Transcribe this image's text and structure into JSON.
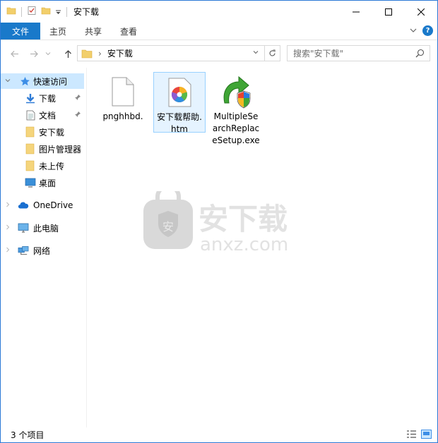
{
  "window": {
    "title": "安下载",
    "accent": "#1979ca"
  },
  "ribbon": {
    "tabs": [
      "文件",
      "主页",
      "共享",
      "查看"
    ],
    "help_label": "?"
  },
  "address": {
    "crumb": "安下载",
    "separator": "›"
  },
  "search": {
    "placeholder": "搜索\"安下载\""
  },
  "navpane": {
    "quick_access": "快速访问",
    "items": [
      {
        "label": "下载",
        "icon": "download-icon",
        "pinned": true
      },
      {
        "label": "文档",
        "icon": "document-icon",
        "pinned": true
      },
      {
        "label": "安下载",
        "icon": "folder-icon",
        "pinned": false
      },
      {
        "label": "图片管理器",
        "icon": "folder-icon",
        "pinned": false
      },
      {
        "label": "未上传",
        "icon": "folder-icon",
        "pinned": false
      },
      {
        "label": "桌面",
        "icon": "desktop-icon",
        "pinned": false
      }
    ],
    "onedrive": "OneDrive",
    "this_pc": "此电脑",
    "network": "网络"
  },
  "files": [
    {
      "name": "pnghhbd.",
      "icon": "blank-file-icon"
    },
    {
      "name": "安下载帮助.htm",
      "icon": "htm-file-icon"
    },
    {
      "name": "MultipleSearchReplaceSetup.exe",
      "icon": "installer-icon"
    }
  ],
  "status": {
    "count": "3 个项目"
  }
}
